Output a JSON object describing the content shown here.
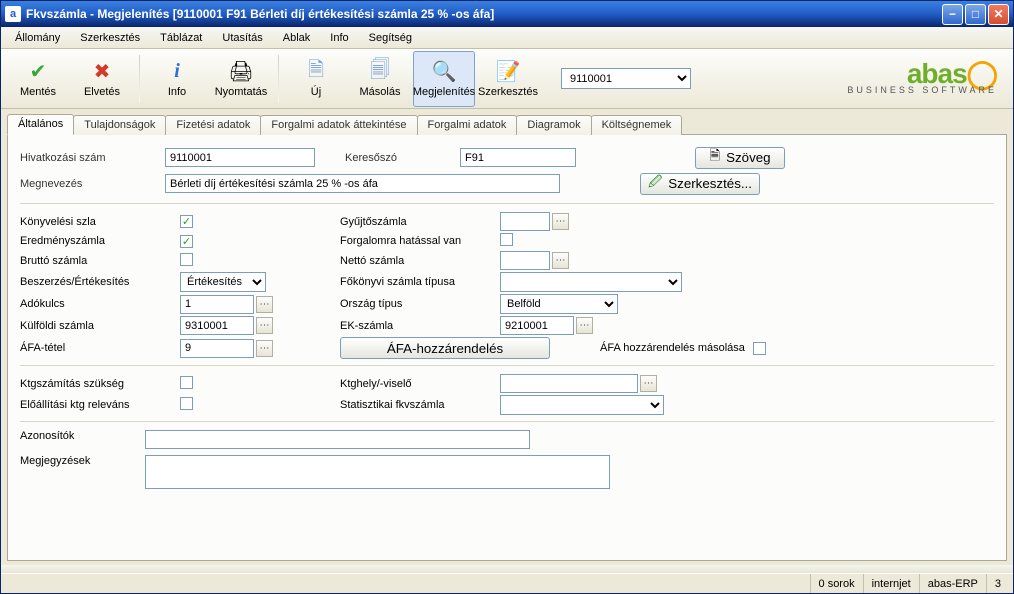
{
  "window": {
    "title": "Fkvszámla - Megjelenítés  [9110001   F91   Bérleti díj értékesítési számla 25 % -os áfa]",
    "app_icon_letter": "a"
  },
  "menu": {
    "items": [
      "Állomány",
      "Szerkesztés",
      "Táblázat",
      "Utasítás",
      "Ablak",
      "Info",
      "Segítség"
    ]
  },
  "toolbar": {
    "save": "Mentés",
    "discard": "Elvetés",
    "info": "Info",
    "print": "Nyomtatás",
    "new": "Új",
    "copy": "Másolás",
    "display": "Megjelenítés",
    "edit": "Szerkesztés",
    "combo_value": "9110001"
  },
  "brand": {
    "name_main": "abas",
    "name_sub": "BUSINESS SOFTWARE"
  },
  "tabs": {
    "items": [
      "Általános",
      "Tulajdonságok",
      "Fizetési adatok",
      "Forgalmi adatok áttekintése",
      "Forgalmi adatok",
      "Diagramok",
      "Költségnemek"
    ],
    "active_index": 0
  },
  "fields": {
    "ref_no_label": "Hivatkozási szám",
    "ref_no": "9110001",
    "search_label": "Keresőszó",
    "search": "F91",
    "text_btn": "Szöveg",
    "name_label": "Megnevezés",
    "name": "Bérleti díj értékesítési számla 25 % -os áfa",
    "edit_btn": "Szerkesztés...",
    "booking_acc_label": "Könyvelési szla",
    "booking_acc_checked": true,
    "collective_label": "Gyűjtőszámla",
    "collective_value": "",
    "result_acc_label": "Eredményszámla",
    "result_acc_checked": true,
    "affects_turnover_label": "Forgalomra hatással van",
    "affects_turnover_checked": false,
    "gross_label": "Bruttó számla",
    "gross_checked": false,
    "net_label": "Nettó számla",
    "net_value": "",
    "purchase_sales_label": "Beszerzés/Értékesítés",
    "purchase_sales_value": "Értékesítés",
    "ledger_type_label": "Főkönyvi számla típusa",
    "ledger_type_value": "",
    "tax_key_label": "Adókulcs",
    "tax_key_value": "1",
    "country_type_label": "Ország típus",
    "country_type_value": "Belföld",
    "foreign_acc_label": "Külföldi számla",
    "foreign_acc_value": "9310001",
    "ec_acc_label": "EK-számla",
    "ec_acc_value": "9210001",
    "vat_item_label": "ÁFA-tétel",
    "vat_item_value": "9",
    "vat_assign_btn": "ÁFA-hozzárendelés",
    "vat_assign_copy_label": "ÁFA hozzárendelés másolása",
    "vat_assign_copy_checked": false,
    "cost_calc_needed_label": "Ktgszámítás szükség",
    "cost_calc_needed_checked": false,
    "cost_place_label": "Ktghely/-viselő",
    "cost_place_value": "",
    "prod_cost_rel_label": "Előállítási ktg releváns",
    "prod_cost_rel_checked": false,
    "stat_ledger_label": "Statisztikai fkvszámla",
    "stat_ledger_value": "",
    "ids_label": "Azonosítók",
    "ids_value": "",
    "notes_label": "Megjegyzések",
    "notes_value": ""
  },
  "status": {
    "rows": "0 sorok",
    "net": "internjet",
    "app": "abas-ERP",
    "num": "3"
  }
}
